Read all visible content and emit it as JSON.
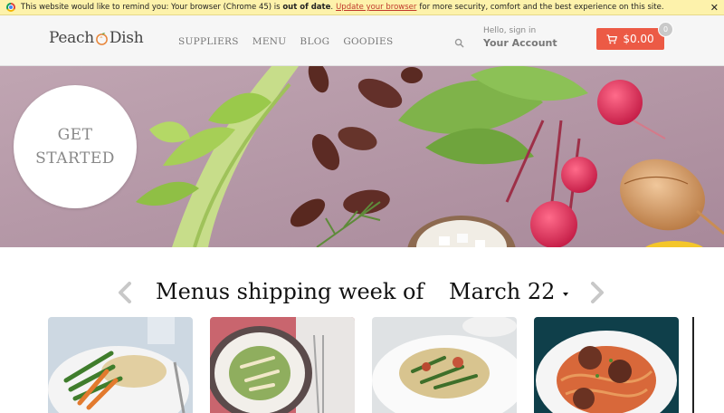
{
  "banner": {
    "text_before": "This website would like to remind you: Your browser (Chrome 45) is",
    "emphasis": "out of date",
    "link": "Update your browser",
    "text_after": "for more security, comfort and the best experience on this site.",
    "close": "✕"
  },
  "header": {
    "logo_left": "Peach",
    "logo_right": "Dish",
    "nav": [
      "SUPPLIERS",
      "MENU",
      "BLOG",
      "GOODIES"
    ],
    "account_hello": "Hello, sign in",
    "account_label": "Your Account",
    "cart_total": "$0.00",
    "cart_count": "0"
  },
  "hero": {
    "cta_line1": "GET",
    "cta_line2": "STARTED"
  },
  "menus": {
    "title": "Menus shipping week of",
    "week": "March 22"
  },
  "colors": {
    "accent": "#ec5a45",
    "banner_bg": "#fdf2ab",
    "hero_bg": "#b89aa8"
  },
  "icons": [
    "chrome-icon",
    "peach-icon",
    "search-icon",
    "cart-icon",
    "chevron-left-icon",
    "chevron-right-icon",
    "caret-down-icon"
  ]
}
